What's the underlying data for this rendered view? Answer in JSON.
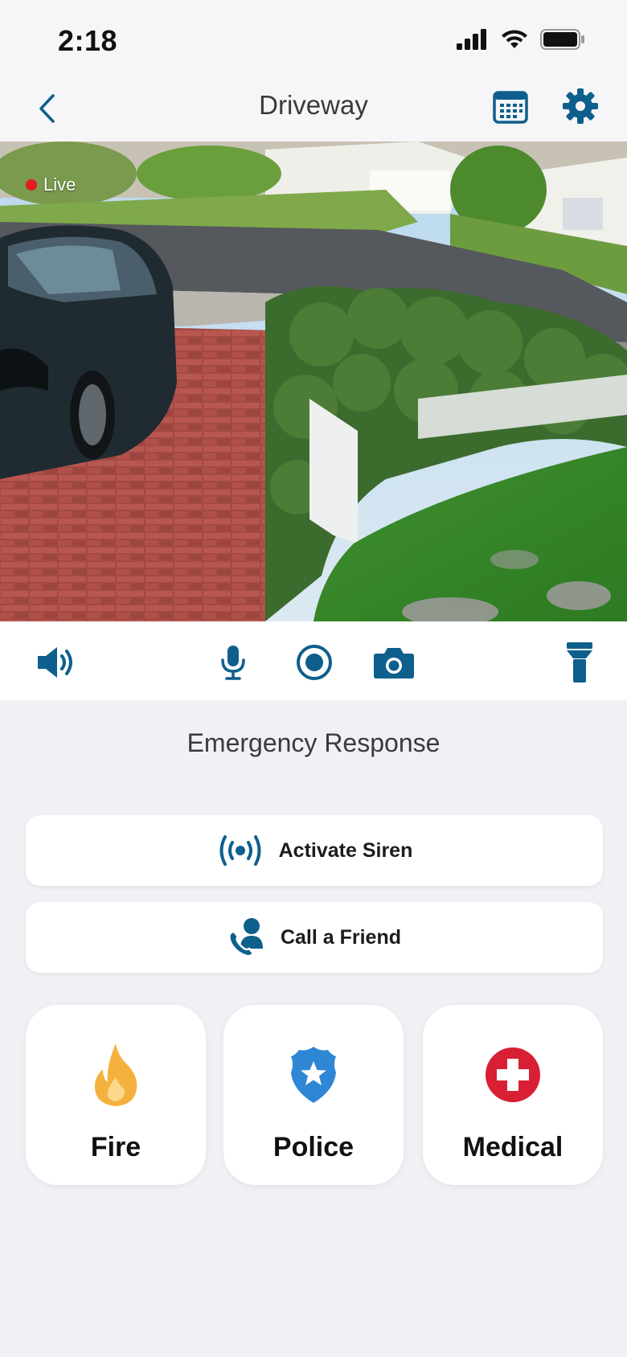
{
  "status_bar": {
    "time": "2:18"
  },
  "nav": {
    "title": "Driveway"
  },
  "video": {
    "live_label": "Live"
  },
  "controls": [
    "speaker-icon",
    "microphone-icon",
    "record-icon",
    "camera-icon",
    "flashlight-icon"
  ],
  "emergency": {
    "title": "Emergency Response",
    "siren_label": "Activate Siren",
    "friend_label": "Call a Friend",
    "tiles": [
      {
        "label": "Fire",
        "icon": "flame-icon",
        "color": "#f5b13d"
      },
      {
        "label": "Police",
        "icon": "police-badge-icon",
        "color": "#2f86d4"
      },
      {
        "label": "Medical",
        "icon": "medical-cross-icon",
        "color": "#d81f33"
      }
    ]
  },
  "colors": {
    "accent": "#0e5f8c",
    "live": "#e31b23",
    "background": "#f0f0f5"
  }
}
